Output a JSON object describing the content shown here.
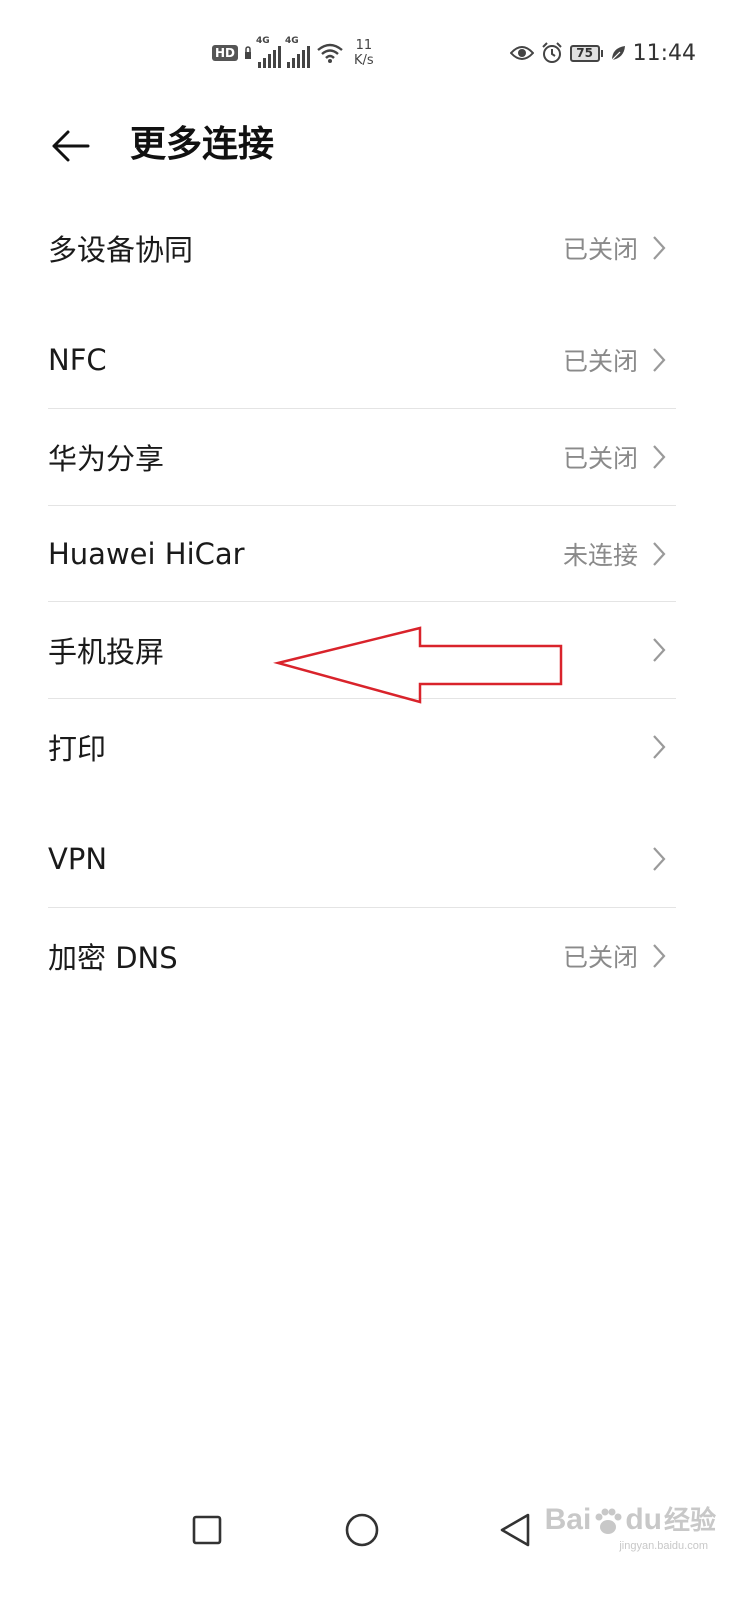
{
  "status_bar": {
    "hd_badge": "HD",
    "signal1_label": "4G",
    "signal2_label": "4G",
    "net_speed_value": "11",
    "net_speed_unit": "K/s",
    "battery_level": "75",
    "time": "11:44",
    "icons": [
      "hd-icon",
      "signal-icon",
      "wifi-icon",
      "eye-icon",
      "alarm-icon",
      "battery-icon",
      "leaf-icon"
    ]
  },
  "header": {
    "title": "更多连接",
    "back_icon": "arrow-left-icon"
  },
  "items": [
    {
      "label": "多设备协同",
      "value": "已关闭"
    },
    {
      "label": "NFC",
      "value": "已关闭"
    },
    {
      "label": "华为分享",
      "value": "已关闭"
    },
    {
      "label": "Huawei HiCar",
      "value": "未连接"
    },
    {
      "label": "手机投屏",
      "value": ""
    },
    {
      "label": "打印",
      "value": ""
    },
    {
      "label": "VPN",
      "value": ""
    },
    {
      "label": "加密 DNS",
      "value": "已关闭"
    }
  ],
  "colors": {
    "annotation_arrow": "#d9232b",
    "secondary_text": "#8a8a8a",
    "divider": "#e4e4e4"
  },
  "watermark": {
    "brand": "Bai",
    "brand2": "du",
    "suffix": "经验",
    "small": "jingyan.baidu.com"
  }
}
